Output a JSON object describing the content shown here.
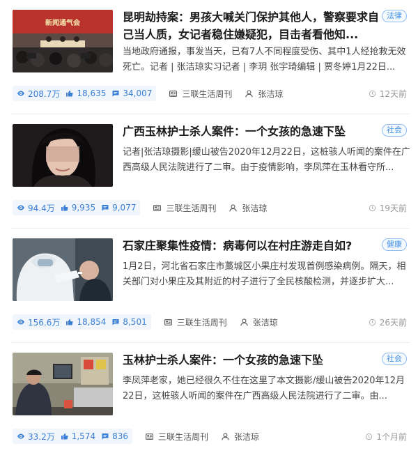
{
  "articles": [
    {
      "title": "昆明劫持案：男孩大喊关门保护其他人，警察要求自己当人质，女记者稳住嫌疑犯，目击者看他知...",
      "summary": "当地政府通报，事发当天，已有7人不同程度受伤、其中1人经抢救无效死亡。记者 | 张洁琼实习记者 | 李玥 张宇琦编辑 | 贾冬婷1月22日...",
      "tag": "法律",
      "views": "208.7万",
      "likes": "18,635",
      "comments": "34,007",
      "source": "三联生活周刊",
      "author": "张洁琼",
      "time": "12天前",
      "thumb_caption": "新闻通气会"
    },
    {
      "title": "广西玉林护士杀人案件：一个女孩的急速下坠",
      "summary": "记者|张洁琼摄影|缓山被告2020年12月22日，这桩骇人听闻的案件在广西高级人民法院进行了二审。由于疫情影响，李凤萍在玉林看守所...",
      "tag": "社会",
      "views": "94.4万",
      "likes": "9,935",
      "comments": "9,077",
      "source": "三联生活周刊",
      "author": "张洁琼",
      "time": "19天前"
    },
    {
      "title": "石家庄聚集性疫情：病毒何以在村庄游走自如?",
      "summary": "1月2日，河北省石家庄市藁城区小果庄村发现首例感染病例。隔天，相关部门对小果庄及其附近的村子进行了全民核酸检测，并逐步扩大...",
      "tag": "健康",
      "views": "156.6万",
      "likes": "18,854",
      "comments": "8,501",
      "source": "三联生活周刊",
      "author": "张洁琼",
      "time": "26天前"
    },
    {
      "title": "玉林护士杀人案件：一个女孩的急速下坠",
      "summary": "李凤萍老家，她已经很久不住在这里了本文摄影/缓山被告2020年12月22日，这桩骇人听闻的案件在广西高级人民法院进行了二审。由...",
      "tag": "社会",
      "views": "33.2万",
      "likes": "1,574",
      "comments": "836",
      "source": "三联生活周刊",
      "author": "张洁琼",
      "time": "1个月前"
    }
  ],
  "colors": {
    "accent": "#3a7fd5",
    "tag_border": "#8dbcf2",
    "stats_bg": "#f1f6fd",
    "muted": "#999999"
  },
  "icons": {
    "views": "eye-icon",
    "likes": "thumbs-up-icon",
    "comments": "comment-icon",
    "source": "newspaper-icon",
    "author": "user-icon",
    "time": "clock-icon"
  }
}
